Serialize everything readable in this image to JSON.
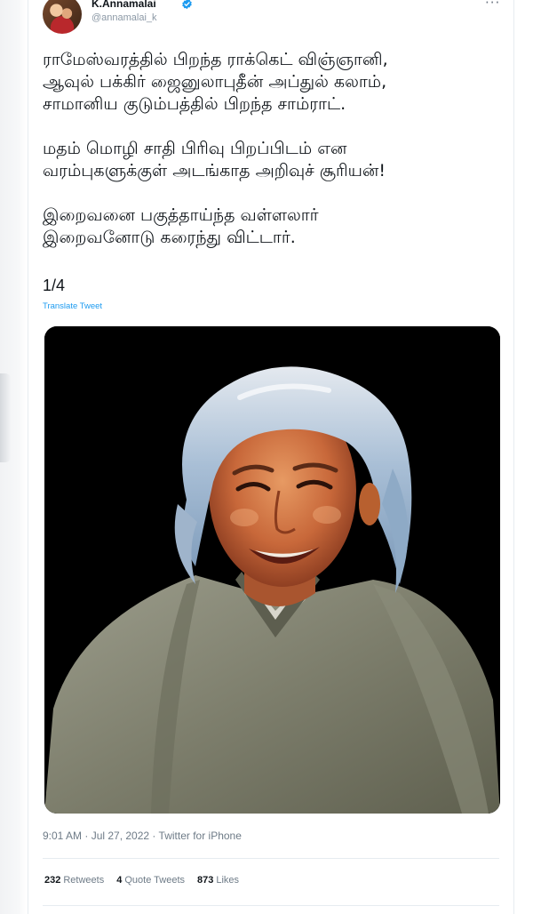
{
  "user": {
    "name": "K.Annamalai",
    "handle": "@annamalai_k",
    "verified": true
  },
  "tweet": {
    "paragraphs": [
      [
        "ராமேஸ்வரத்தில் பிறந்த ராக்கெட் விஞ்ஞானி,",
        "ஆவுல் பக்கிர் ஜைனுலாபுதீன் அப்துல் கலாம்,",
        "சாமானிய குடும்பத்தில் பிறந்த சாம்ராட்."
      ],
      [
        "மதம் மொழி சாதி பிரிவு பிறப்பிடம் என",
        "வரம்புகளுக்குள் அடங்காத அறிவுச் சூரியன்!"
      ],
      [
        "இறைவனை பகுத்தாய்ந்த வள்ளலார்",
        "இறைவனோடு கரைந்து விட்டார்."
      ]
    ],
    "thread_counter": "1/4",
    "translate_label": "Translate Tweet",
    "meta": "9:01 AM · Jul 27, 2022 · Twitter for iPhone"
  },
  "stats": [
    {
      "count": "232",
      "label": "Retweets"
    },
    {
      "count": "4",
      "label": "Quote Tweets"
    },
    {
      "count": "873",
      "label": "Likes"
    }
  ],
  "colors": {
    "link": "#1d9bf0",
    "text": "#0f1419",
    "muted": "#6e7b87",
    "border": "#e6ecf0"
  },
  "icons": {
    "verified": "verified-badge-icon",
    "more": "more-options-icon"
  }
}
